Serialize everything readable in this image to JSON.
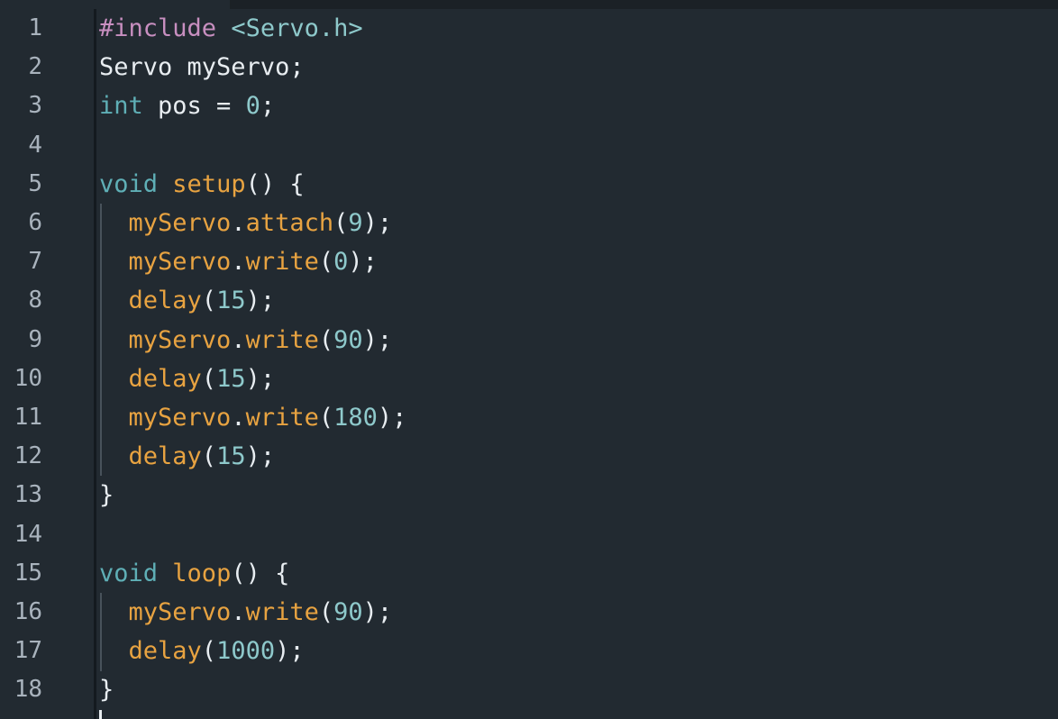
{
  "colors": {
    "background": "#222a31",
    "gutter_text": "#a9b3bd",
    "directive": "#c88fc0",
    "header": "#8ec9cb",
    "keyword": "#5fafb6",
    "function": "#e8a341",
    "number": "#8ec9cb",
    "plain": "#e8edf1"
  },
  "editor": {
    "lines": [
      {
        "number": "1",
        "tokens": [
          {
            "text": "#include",
            "kind": "directive"
          },
          {
            "text": " ",
            "kind": "plain"
          },
          {
            "text": "<Servo.h>",
            "kind": "header"
          }
        ]
      },
      {
        "number": "2",
        "tokens": [
          {
            "text": "Servo myServo;",
            "kind": "plain"
          }
        ]
      },
      {
        "number": "3",
        "tokens": [
          {
            "text": "int",
            "kind": "keyword"
          },
          {
            "text": " pos = ",
            "kind": "plain"
          },
          {
            "text": "0",
            "kind": "number"
          },
          {
            "text": ";",
            "kind": "plain"
          }
        ]
      },
      {
        "number": "4",
        "tokens": []
      },
      {
        "number": "5",
        "tokens": [
          {
            "text": "void",
            "kind": "keyword"
          },
          {
            "text": " ",
            "kind": "plain"
          },
          {
            "text": "setup",
            "kind": "function"
          },
          {
            "text": "() {",
            "kind": "plain"
          }
        ]
      },
      {
        "number": "6",
        "tokens": [
          {
            "text": "  ",
            "kind": "plain"
          },
          {
            "text": "myServo",
            "kind": "function"
          },
          {
            "text": ".",
            "kind": "plain"
          },
          {
            "text": "attach",
            "kind": "function"
          },
          {
            "text": "(",
            "kind": "plain"
          },
          {
            "text": "9",
            "kind": "number"
          },
          {
            "text": ");",
            "kind": "plain"
          }
        ]
      },
      {
        "number": "7",
        "tokens": [
          {
            "text": "  ",
            "kind": "plain"
          },
          {
            "text": "myServo",
            "kind": "function"
          },
          {
            "text": ".",
            "kind": "plain"
          },
          {
            "text": "write",
            "kind": "function"
          },
          {
            "text": "(",
            "kind": "plain"
          },
          {
            "text": "0",
            "kind": "number"
          },
          {
            "text": ");",
            "kind": "plain"
          }
        ]
      },
      {
        "number": "8",
        "tokens": [
          {
            "text": "  ",
            "kind": "plain"
          },
          {
            "text": "delay",
            "kind": "function"
          },
          {
            "text": "(",
            "kind": "plain"
          },
          {
            "text": "15",
            "kind": "number"
          },
          {
            "text": ");",
            "kind": "plain"
          }
        ]
      },
      {
        "number": "9",
        "tokens": [
          {
            "text": "  ",
            "kind": "plain"
          },
          {
            "text": "myServo",
            "kind": "function"
          },
          {
            "text": ".",
            "kind": "plain"
          },
          {
            "text": "write",
            "kind": "function"
          },
          {
            "text": "(",
            "kind": "plain"
          },
          {
            "text": "90",
            "kind": "number"
          },
          {
            "text": ");",
            "kind": "plain"
          }
        ]
      },
      {
        "number": "10",
        "tokens": [
          {
            "text": "  ",
            "kind": "plain"
          },
          {
            "text": "delay",
            "kind": "function"
          },
          {
            "text": "(",
            "kind": "plain"
          },
          {
            "text": "15",
            "kind": "number"
          },
          {
            "text": ");",
            "kind": "plain"
          }
        ]
      },
      {
        "number": "11",
        "tokens": [
          {
            "text": "  ",
            "kind": "plain"
          },
          {
            "text": "myServo",
            "kind": "function"
          },
          {
            "text": ".",
            "kind": "plain"
          },
          {
            "text": "write",
            "kind": "function"
          },
          {
            "text": "(",
            "kind": "plain"
          },
          {
            "text": "180",
            "kind": "number"
          },
          {
            "text": ");",
            "kind": "plain"
          }
        ]
      },
      {
        "number": "12",
        "tokens": [
          {
            "text": "  ",
            "kind": "plain"
          },
          {
            "text": "delay",
            "kind": "function"
          },
          {
            "text": "(",
            "kind": "plain"
          },
          {
            "text": "15",
            "kind": "number"
          },
          {
            "text": ");",
            "kind": "plain"
          }
        ]
      },
      {
        "number": "13",
        "tokens": [
          {
            "text": "}",
            "kind": "plain"
          }
        ]
      },
      {
        "number": "14",
        "tokens": []
      },
      {
        "number": "15",
        "tokens": [
          {
            "text": "void",
            "kind": "keyword"
          },
          {
            "text": " ",
            "kind": "plain"
          },
          {
            "text": "loop",
            "kind": "function"
          },
          {
            "text": "() {",
            "kind": "plain"
          }
        ]
      },
      {
        "number": "16",
        "tokens": [
          {
            "text": "  ",
            "kind": "plain"
          },
          {
            "text": "myServo",
            "kind": "function"
          },
          {
            "text": ".",
            "kind": "plain"
          },
          {
            "text": "write",
            "kind": "function"
          },
          {
            "text": "(",
            "kind": "plain"
          },
          {
            "text": "90",
            "kind": "number"
          },
          {
            "text": ");",
            "kind": "plain"
          }
        ]
      },
      {
        "number": "17",
        "tokens": [
          {
            "text": "  ",
            "kind": "plain"
          },
          {
            "text": "delay",
            "kind": "function"
          },
          {
            "text": "(",
            "kind": "plain"
          },
          {
            "text": "1000",
            "kind": "number"
          },
          {
            "text": ");",
            "kind": "plain"
          }
        ]
      },
      {
        "number": "18",
        "tokens": [
          {
            "text": "}",
            "kind": "plain"
          }
        ]
      }
    ]
  }
}
